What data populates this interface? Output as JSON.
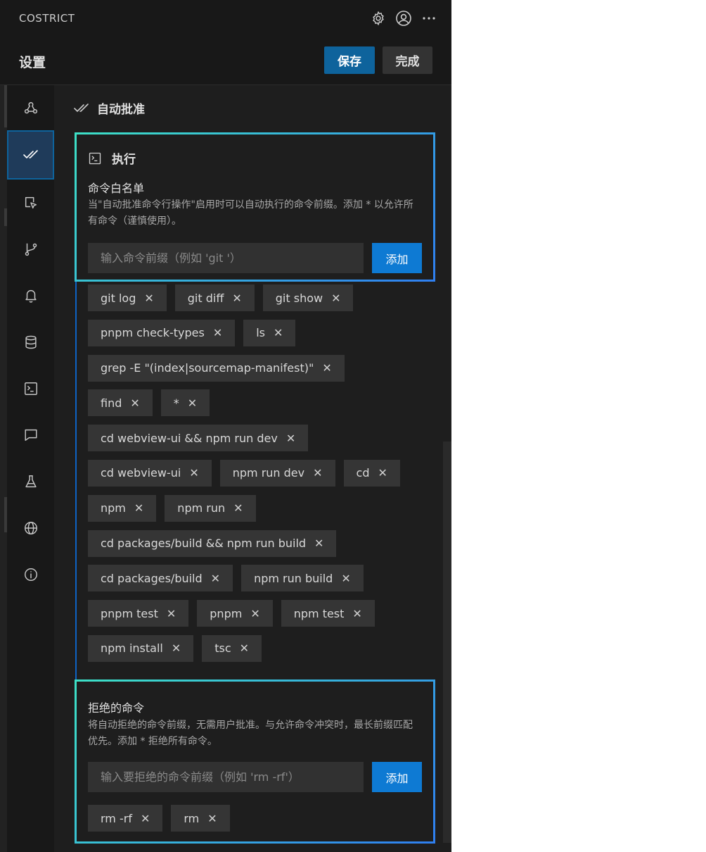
{
  "window": {
    "app_title": "COSTRICT"
  },
  "header": {
    "title": "设置",
    "save_label": "保存",
    "done_label": "完成"
  },
  "sidebar": {
    "items": [
      {
        "icon": "webhook-icon"
      },
      {
        "icon": "double-check-icon",
        "active": true
      },
      {
        "icon": "cursor-click-icon"
      },
      {
        "icon": "git-branch-icon"
      },
      {
        "icon": "bell-icon"
      },
      {
        "icon": "database-icon"
      },
      {
        "icon": "terminal-icon"
      },
      {
        "icon": "chat-icon"
      },
      {
        "icon": "flask-icon"
      },
      {
        "icon": "globe-icon"
      },
      {
        "icon": "info-icon"
      }
    ]
  },
  "section": {
    "title": "自动批准"
  },
  "execute": {
    "title": "执行",
    "whitelist_label": "命令白名单",
    "whitelist_desc": "当\"自动批准命令行操作\"启用时可以自动执行的命令前缀。添加 * 以允许所有命令（谨慎使用）。",
    "input_placeholder": "输入命令前缀（例如 'git '）",
    "add_label": "添加",
    "allowed_rows": [
      [
        "git log",
        "git diff",
        "git show"
      ],
      [
        "pnpm check-types",
        "ls"
      ],
      [
        "grep -E \"(index|sourcemap-manifest)\""
      ],
      [
        "find",
        "*"
      ],
      [
        "cd webview-ui && npm run dev"
      ],
      [
        "cd webview-ui",
        "npm run dev",
        "cd"
      ],
      [
        "npm",
        "npm run"
      ],
      [
        "cd packages/build && npm run build"
      ],
      [
        "cd packages/build",
        "npm run build"
      ],
      [
        "pnpm test",
        "pnpm",
        "npm test"
      ],
      [
        "npm install",
        "tsc"
      ]
    ]
  },
  "deny": {
    "label": "拒绝的命令",
    "desc": "将自动拒绝的命令前缀，无需用户批准。与允许命令冲突时，最长前缀匹配优先。添加 * 拒绝所有命令。",
    "input_placeholder": "输入要拒绝的命令前缀（例如 'rm -rf'）",
    "add_label": "添加",
    "tags": [
      "rm -rf",
      "rm"
    ]
  },
  "colors": {
    "accent": "#0e639c",
    "border_gradient": [
      "#3de0c6",
      "#2f7ff0"
    ]
  }
}
